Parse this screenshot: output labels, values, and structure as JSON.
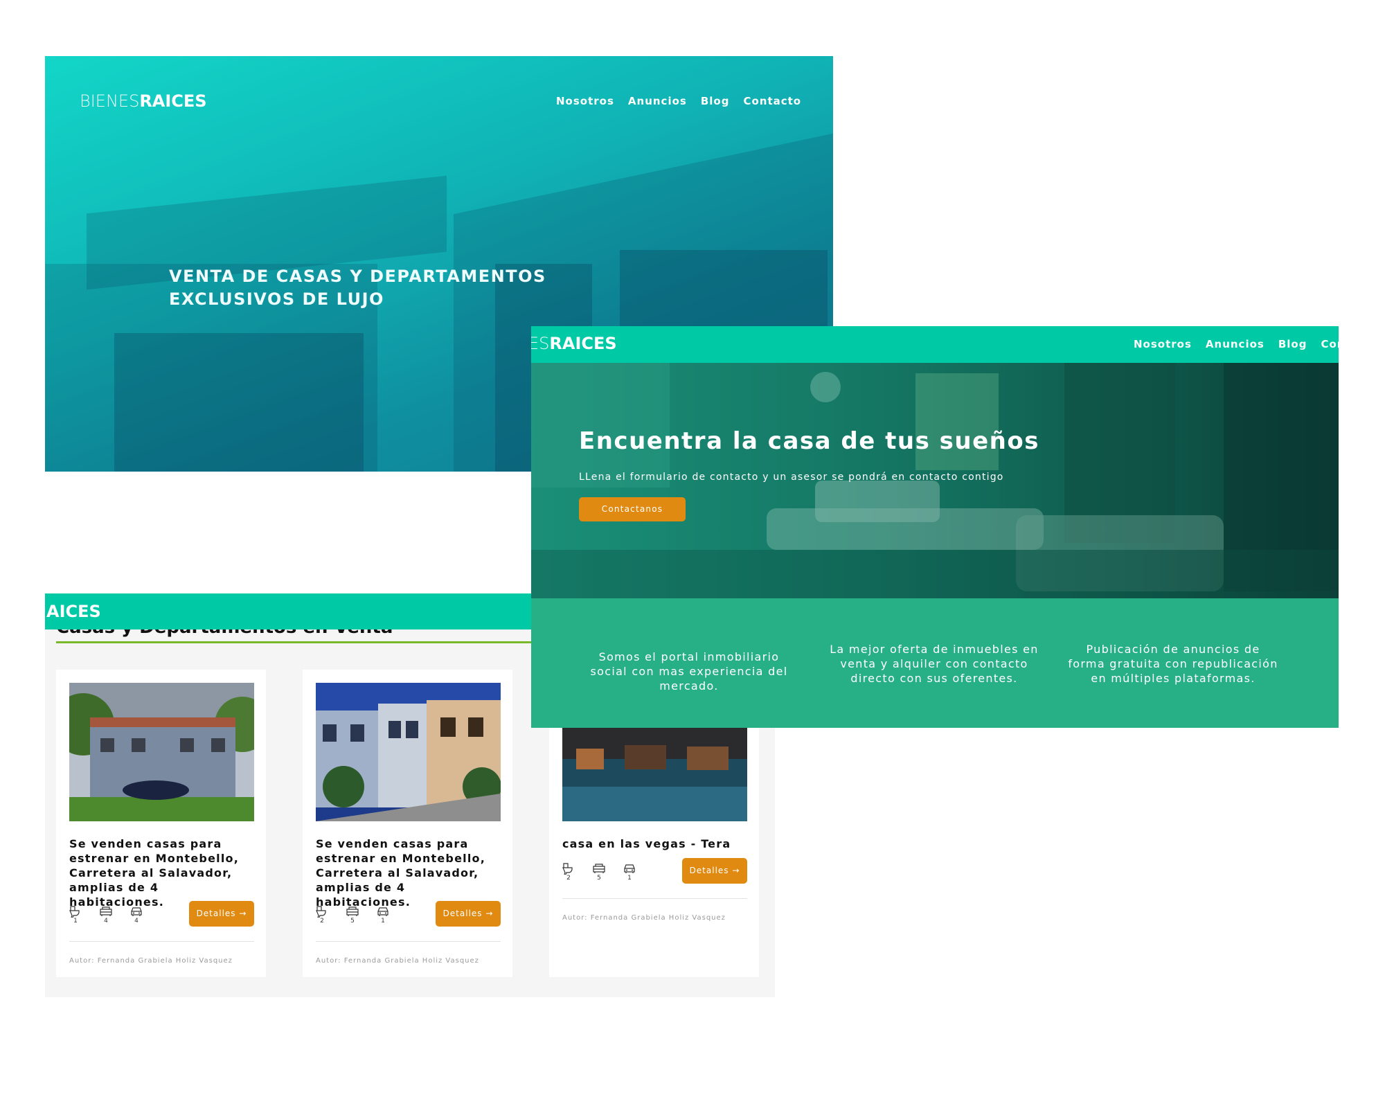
{
  "hero": {
    "logo_thin": "BIENES",
    "logo_bold": "RAICES",
    "nav": [
      "Nosotros",
      "Anuncios",
      "Blog",
      "Contacto"
    ],
    "headline_line1": "VENTA DE CASAS Y DEPARTAMENTOS",
    "headline_line2": "EXCLUSIVOS DE LUJO"
  },
  "listings": {
    "logo_partial": "AICES",
    "section_title": "Casas y Departamentos en Venta",
    "cards": [
      {
        "title": "Se venden casas para estrenar en Montebello, Carretera al Salavador, amplias de 4 habitaciones.",
        "baths": "1",
        "rooms": "4",
        "parking": "4",
        "button": "Detalles →",
        "author": "Autor: Fernanda Grabiela Holiz Vasquez"
      },
      {
        "title": "Se venden casas para estrenar en Montebello, Carretera al Salavador, amplias de 4 habitaciones.",
        "baths": "2",
        "rooms": "5",
        "parking": "1",
        "button": "Detalles →",
        "author": "Autor: Fernanda Grabiela Holiz Vasquez"
      },
      {
        "title": "casa en las vegas - Tera",
        "baths": "2",
        "rooms": "5",
        "parking": "1",
        "button": "Detalles →",
        "author": "Autor: Fernanda Grabiela Holiz Vasquez"
      }
    ]
  },
  "front": {
    "logo_thin": "ES",
    "logo_bold": "RAICES",
    "nav": [
      "Nosotros",
      "Anuncios",
      "Blog",
      "Cont"
    ],
    "title": "Encuentra la casa de tus sueños",
    "subtitle": "LLena el formulario de contacto y un asesor se pondrá en contacto contigo",
    "cta": "Contactanos",
    "features": [
      "Somos el portal inmobiliario social con mas experiencia del mercado.",
      "La mejor oferta de inmuebles en venta y alquiler con contacto directo con sus oferentes.",
      "Publicación de anuncios de forma gratuita con republicación en múltiples plataformas."
    ]
  },
  "colors": {
    "teal": "#00c9a6",
    "green": "#27af86",
    "orange": "#e08a12",
    "accent_line": "#79b928"
  }
}
